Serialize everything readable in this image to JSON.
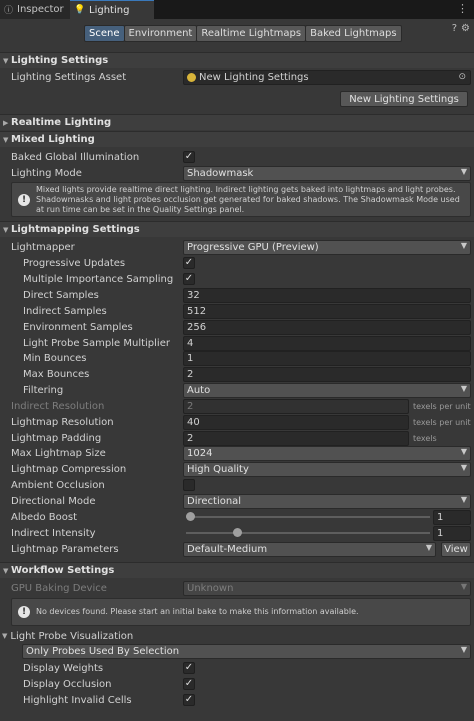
{
  "window_tabs": [
    {
      "label": "Inspector",
      "icon": "inspector-icon"
    },
    {
      "label": "Lighting",
      "icon": "lightbulb-icon"
    }
  ],
  "top_icons": {
    "help": "?",
    "settings": "⚙",
    "menu": "⋮"
  },
  "scope_tabs": [
    "Scene",
    "Environment",
    "Realtime Lightmaps",
    "Baked Lightmaps"
  ],
  "lighting_settings": {
    "header": "Lighting Settings",
    "asset_label": "Lighting Settings Asset",
    "asset_value": "New Lighting Settings",
    "new_button": "New Lighting Settings"
  },
  "realtime_lighting": {
    "header": "Realtime Lighting"
  },
  "mixed_lighting": {
    "header": "Mixed Lighting",
    "bgi_label": "Baked Global Illumination",
    "bgi_checked": true,
    "mode_label": "Lighting Mode",
    "mode_value": "Shadowmask",
    "help": "Mixed lights provide realtime direct lighting. Indirect lighting gets baked into lightmaps and light probes. Shadowmasks and light probes occlusion get generated for baked shadows. The Shadowmask Mode used at run time can be set in the Quality Settings panel."
  },
  "lightmapping": {
    "header": "Lightmapping Settings",
    "lightmapper_label": "Lightmapper",
    "lightmapper_value": "Progressive GPU (Preview)",
    "progressive_updates_label": "Progressive Updates",
    "mis_label": "Multiple Importance Sampling",
    "direct_samples_label": "Direct Samples",
    "direct_samples": "32",
    "indirect_samples_label": "Indirect Samples",
    "indirect_samples": "512",
    "env_samples_label": "Environment Samples",
    "env_samples": "256",
    "probe_mult_label": "Light Probe Sample Multiplier",
    "probe_mult": "4",
    "min_bounces_label": "Min Bounces",
    "min_bounces": "1",
    "max_bounces_label": "Max Bounces",
    "max_bounces": "2",
    "filtering_label": "Filtering",
    "filtering_value": "Auto",
    "indirect_res_label": "Indirect Resolution",
    "indirect_res": "2",
    "indirect_res_unit": "texels per unit",
    "lightmap_res_label": "Lightmap Resolution",
    "lightmap_res": "40",
    "lightmap_res_unit": "texels per unit",
    "padding_label": "Lightmap Padding",
    "padding": "2",
    "padding_unit": "texels",
    "max_size_label": "Max Lightmap Size",
    "max_size": "1024",
    "compression_label": "Lightmap Compression",
    "compression": "High Quality",
    "ao_label": "Ambient Occlusion",
    "dir_mode_label": "Directional Mode",
    "dir_mode": "Directional",
    "albedo_label": "Albedo Boost",
    "albedo_value": "1",
    "albedo_fraction": 0.0,
    "indirect_intensity_label": "Indirect Intensity",
    "indirect_intensity_value": "1",
    "indirect_intensity_fraction": 0.2,
    "params_label": "Lightmap Parameters",
    "params_value": "Default-Medium",
    "view_button": "View"
  },
  "workflow": {
    "header": "Workflow Settings",
    "gpu_label": "GPU Baking Device",
    "gpu_value": "Unknown",
    "help": "No devices found. Please start an initial bake to make this information available."
  },
  "probe_vis": {
    "label": "Light Probe Visualization",
    "mode_value": "Only Probes Used By Selection",
    "weights_label": "Display Weights",
    "occlusion_label": "Display Occlusion",
    "invalid_label": "Highlight Invalid Cells"
  }
}
